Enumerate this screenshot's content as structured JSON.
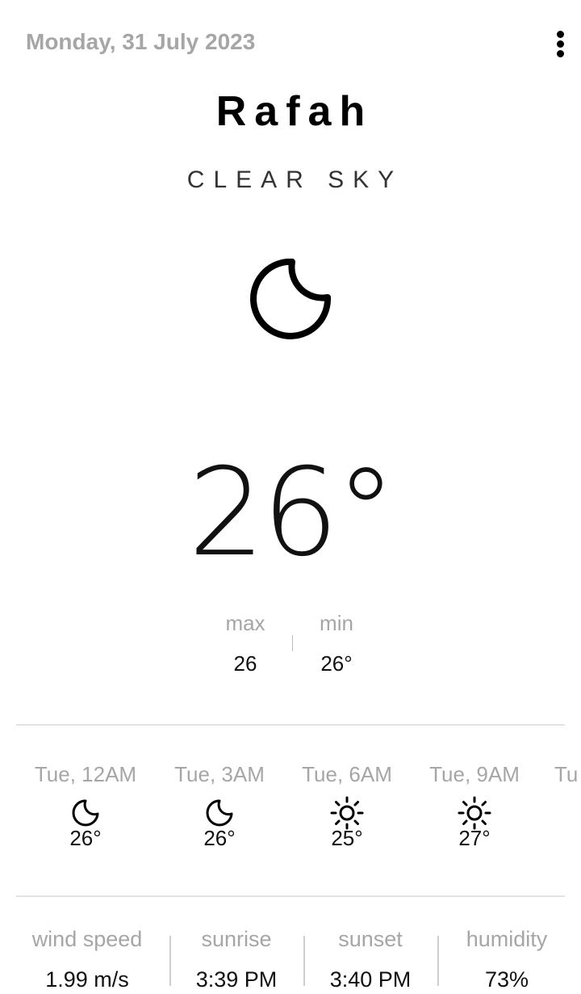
{
  "header": {
    "date": "Monday, 31 July 2023",
    "menu_icon": "more-vertical-icon"
  },
  "current": {
    "city": "Rafah",
    "condition": "CLEAR SKY",
    "icon": "moon-icon",
    "temperature": "26",
    "degree_symbol": "°"
  },
  "range": {
    "max_label": "max",
    "min_label": "min",
    "max_value": "26",
    "min_value": "26°"
  },
  "forecast": [
    {
      "time": "Tue, 12AM",
      "icon": "moon-icon",
      "temp": "26°"
    },
    {
      "time": "Tue, 3AM",
      "icon": "moon-icon",
      "temp": "26°"
    },
    {
      "time": "Tue, 6AM",
      "icon": "sun-icon",
      "temp": "25°"
    },
    {
      "time": "Tue, 9AM",
      "icon": "sun-icon",
      "temp": "27°"
    },
    {
      "time": "Tu",
      "icon": "",
      "temp": ""
    }
  ],
  "details": {
    "wind_speed_label": "wind speed",
    "wind_speed_value": "1.99 m/s",
    "sunrise_label": "sunrise",
    "sunrise_value": "3:39 PM",
    "sunset_label": "sunset",
    "sunset_value": "3:40 PM",
    "humidity_label": "humidity",
    "humidity_value": "73%"
  }
}
